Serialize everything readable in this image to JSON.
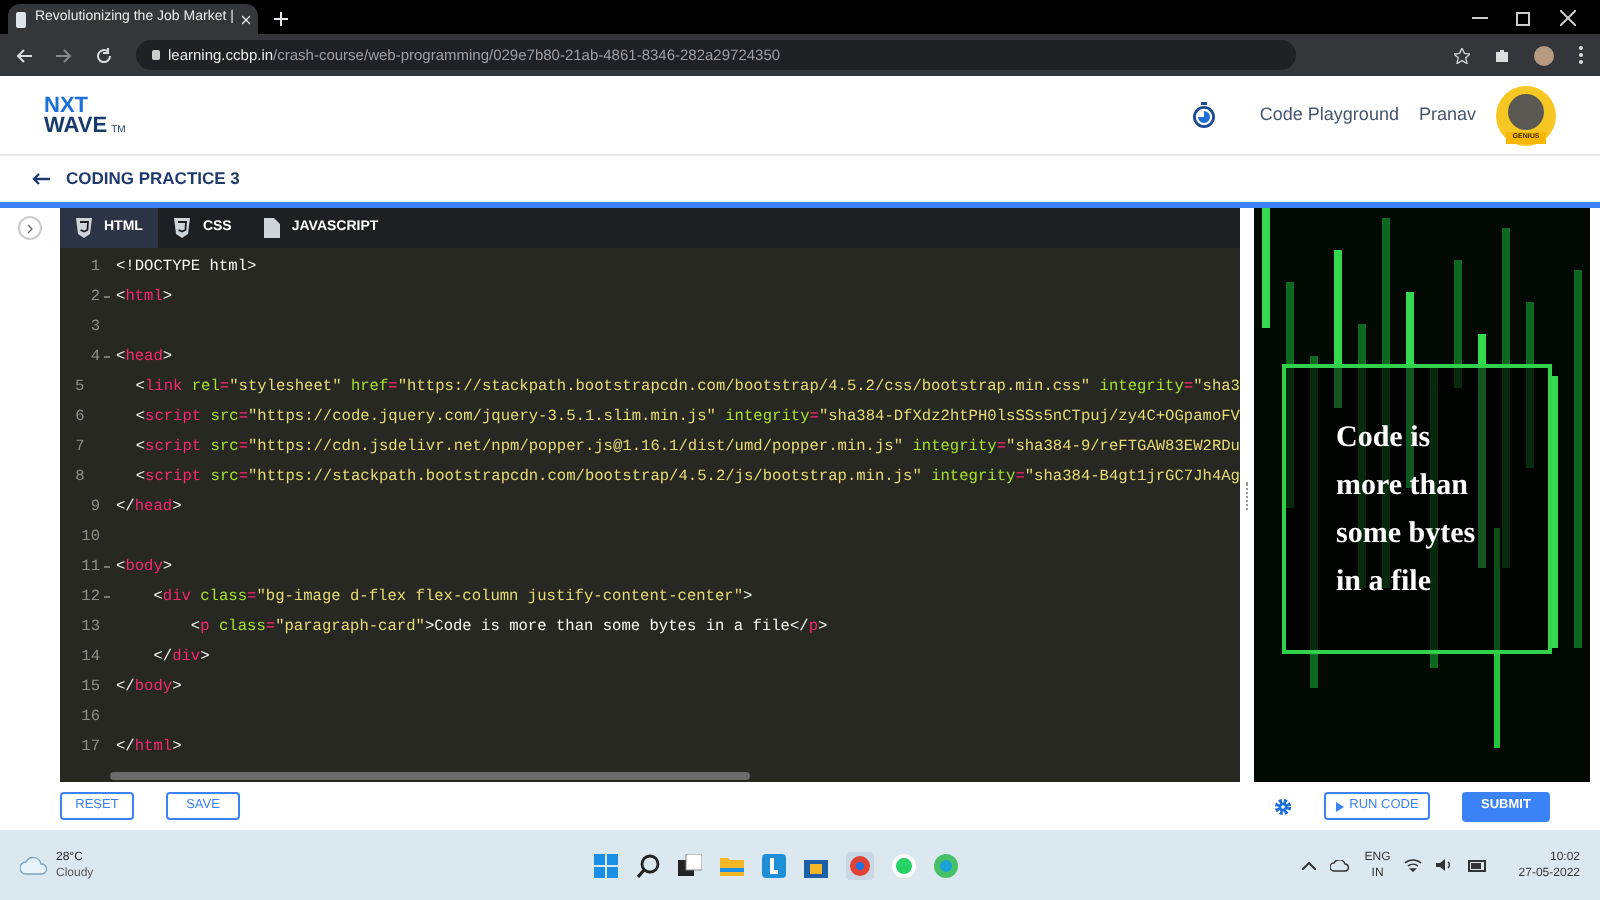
{
  "browser": {
    "tab_title": "Revolutionizing the Job Market |",
    "url_host": "learning.ccbp.in",
    "url_path": "/crash-course/web-programming/029e7b80-21ab-4861-8346-282a29724350"
  },
  "header": {
    "logo_top": "NXT",
    "logo_bottom": "WAVE",
    "logo_mark": "TM",
    "nav_link": "Code Playground",
    "user_name": "Pranav",
    "badge": "GENIUS"
  },
  "page_title": "CODING PRACTICE 3",
  "editor_tabs": [
    {
      "label": "HTML",
      "kind": "html",
      "selected": true
    },
    {
      "label": "CSS",
      "kind": "css",
      "selected": false
    },
    {
      "label": "JAVASCRIPT",
      "kind": "js",
      "selected": false
    }
  ],
  "code_lines": [
    {
      "number": "1",
      "foldable": false,
      "tokens": [
        {
          "kind": "text",
          "text": "<!DOCTYPE html>"
        }
      ]
    },
    {
      "number": "2",
      "foldable": true,
      "tokens": [
        {
          "kind": "punct",
          "text": "<"
        },
        {
          "kind": "tag",
          "text": "html"
        },
        {
          "kind": "punct",
          "text": ">"
        }
      ]
    },
    {
      "number": "3",
      "foldable": false
    },
    {
      "number": "4",
      "foldable": true,
      "tokens": [
        {
          "kind": "punct",
          "text": "<"
        },
        {
          "kind": "tag",
          "text": "head"
        },
        {
          "kind": "punct",
          "text": ">"
        }
      ]
    },
    {
      "number": "5",
      "foldable": false,
      "tokens": [
        {
          "kind": "punct",
          "text": "    <"
        },
        {
          "kind": "tag",
          "text": "link"
        },
        {
          "kind": "attr",
          "text": " rel"
        },
        {
          "kind": "tag",
          "text": "="
        },
        {
          "kind": "string",
          "text": "\"stylesheet\""
        },
        {
          "kind": "attr",
          "text": " href"
        },
        {
          "kind": "tag",
          "text": "="
        },
        {
          "kind": "string",
          "text": "\"https://stackpath.bootstrapcdn.com/bootstrap/4.5.2/css/bootstrap.min.css\""
        },
        {
          "kind": "attr",
          "text": " integrity"
        },
        {
          "kind": "tag",
          "text": "="
        },
        {
          "kind": "string",
          "text": "\"sha3"
        }
      ]
    },
    {
      "number": "6",
      "foldable": false,
      "tokens": [
        {
          "kind": "punct",
          "text": "    <"
        },
        {
          "kind": "tag",
          "text": "script"
        },
        {
          "kind": "attr",
          "text": " src"
        },
        {
          "kind": "tag",
          "text": "="
        },
        {
          "kind": "string",
          "text": "\"https://code.jquery.com/jquery-3.5.1.slim.min.js\""
        },
        {
          "kind": "attr",
          "text": " integrity"
        },
        {
          "kind": "tag",
          "text": "="
        },
        {
          "kind": "string",
          "text": "\"sha384-DfXdz2htPH0lsSSs5nCTpuj/zy4C+OGpamoFV"
        }
      ]
    },
    {
      "number": "7",
      "foldable": false,
      "tokens": [
        {
          "kind": "punct",
          "text": "    <"
        },
        {
          "kind": "tag",
          "text": "script"
        },
        {
          "kind": "attr",
          "text": " src"
        },
        {
          "kind": "tag",
          "text": "="
        },
        {
          "kind": "string",
          "text": "\"https://cdn.jsdelivr.net/npm/popper.js@1.16.1/dist/umd/popper.min.js\""
        },
        {
          "kind": "attr",
          "text": " integrity"
        },
        {
          "kind": "tag",
          "text": "="
        },
        {
          "kind": "string",
          "text": "\"sha384-9/reFTGAW83EW2RDu"
        }
      ]
    },
    {
      "number": "8",
      "foldable": false,
      "tokens": [
        {
          "kind": "punct",
          "text": "    <"
        },
        {
          "kind": "tag",
          "text": "script"
        },
        {
          "kind": "attr",
          "text": " src"
        },
        {
          "kind": "tag",
          "text": "="
        },
        {
          "kind": "string",
          "text": "\"https://stackpath.bootstrapcdn.com/bootstrap/4.5.2/js/bootstrap.min.js\""
        },
        {
          "kind": "attr",
          "text": " integrity"
        },
        {
          "kind": "tag",
          "text": "="
        },
        {
          "kind": "string",
          "text": "\"sha384-B4gt1jrGC7Jh4Ag"
        }
      ]
    },
    {
      "number": "9",
      "foldable": false,
      "tokens": [
        {
          "kind": "punct",
          "text": "</"
        },
        {
          "kind": "tag",
          "text": "head"
        },
        {
          "kind": "punct",
          "text": ">"
        }
      ]
    },
    {
      "number": "10",
      "foldable": false
    },
    {
      "number": "11",
      "foldable": true,
      "tokens": [
        {
          "kind": "punct",
          "text": "<"
        },
        {
          "kind": "tag",
          "text": "body"
        },
        {
          "kind": "punct",
          "text": ">"
        }
      ]
    },
    {
      "number": "12",
      "foldable": true,
      "tokens": [
        {
          "kind": "punct",
          "text": "    <"
        },
        {
          "kind": "tag",
          "text": "div"
        },
        {
          "kind": "attr",
          "text": " class"
        },
        {
          "kind": "tag",
          "text": "="
        },
        {
          "kind": "string",
          "text": "\"bg-image d-flex flex-column justify-content-center\""
        },
        {
          "kind": "punct",
          "text": ">"
        }
      ]
    },
    {
      "number": "13",
      "foldable": false,
      "tokens": [
        {
          "kind": "punct",
          "text": "        <"
        },
        {
          "kind": "tag",
          "text": "p"
        },
        {
          "kind": "attr",
          "text": " class"
        },
        {
          "kind": "tag",
          "text": "="
        },
        {
          "kind": "string",
          "text": "\"paragraph-card\""
        },
        {
          "kind": "punct",
          "text": ">"
        },
        {
          "kind": "text",
          "text": "Code is more than some bytes in a file"
        },
        {
          "kind": "punct",
          "text": "</"
        },
        {
          "kind": "tag",
          "text": "p"
        },
        {
          "kind": "punct",
          "text": ">"
        }
      ]
    },
    {
      "number": "14",
      "foldable": false,
      "tokens": [
        {
          "kind": "punct",
          "text": "    </"
        },
        {
          "kind": "tag",
          "text": "div"
        },
        {
          "kind": "punct",
          "text": ">"
        }
      ]
    },
    {
      "number": "15",
      "foldable": false,
      "tokens": [
        {
          "kind": "punct",
          "text": "</"
        },
        {
          "kind": "tag",
          "text": "body"
        },
        {
          "kind": "punct",
          "text": ">"
        }
      ]
    },
    {
      "number": "16",
      "foldable": false
    },
    {
      "number": "17",
      "foldable": false,
      "tokens": [
        {
          "kind": "punct",
          "text": "</"
        },
        {
          "kind": "tag",
          "text": "html"
        },
        {
          "kind": "punct",
          "text": ">"
        }
      ]
    }
  ],
  "buttons": {
    "reset": "RESET",
    "save": "SAVE",
    "run": "RUN CODE",
    "submit": "SUBMIT"
  },
  "preview": {
    "kind": "picture",
    "card_text": "Code is more than some bytes in a file"
  },
  "taskbar": {
    "temperature": "28°C",
    "weather": "Cloudy",
    "language": "ENG",
    "region": "IN",
    "time": "10:02",
    "date": "27-05-2022"
  }
}
